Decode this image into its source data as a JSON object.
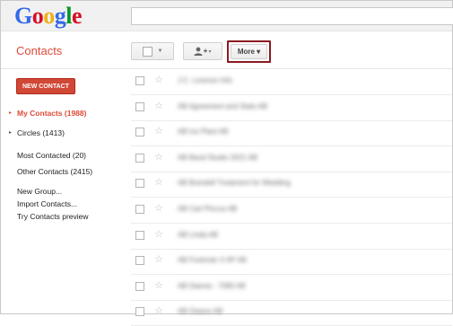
{
  "header": {
    "logo_letters": [
      {
        "char": "G",
        "color": "#3369e8"
      },
      {
        "char": "o",
        "color": "#d50f25"
      },
      {
        "char": "o",
        "color": "#eeb211"
      },
      {
        "char": "g",
        "color": "#3369e8"
      },
      {
        "char": "l",
        "color": "#009925"
      },
      {
        "char": "e",
        "color": "#d50f25"
      }
    ],
    "search_value": ""
  },
  "toolbar": {
    "app_title": "Contacts",
    "select_caret": "▼",
    "add_icon": "add-person-icon",
    "add_label": "+▾",
    "more_label": "More ▾"
  },
  "sidebar": {
    "new_contact_label": "NEW CONTACT",
    "my_contacts": "My Contacts (1988)",
    "circles": "Circles (1413)",
    "most_contacted": "Most Contacted (20)",
    "other_contacts": "Other Contacts (2415)",
    "new_group": "New Group...",
    "import_contacts": "Import Contacts...",
    "try_preview": "Try Contacts preview"
  },
  "contacts": [
    {
      "name": "J.C. Lorenzo Info"
    },
    {
      "name": "AB Agreement and Stats AB"
    },
    {
      "name": "AB Ice Plant AB"
    },
    {
      "name": "AB Band Studio 2021 AB"
    },
    {
      "name": "AB Brandell Treatment for Wedding"
    },
    {
      "name": "AB Carl Pincus AB"
    },
    {
      "name": "AB Linda AB"
    },
    {
      "name": "AB Footnote X AP AB"
    },
    {
      "name": "AB Dianne - 7085 AB"
    },
    {
      "name": "AB Owens AB"
    }
  ],
  "colors": {
    "accent_red": "#dd4b39",
    "new_contact_bg": "#d14836",
    "more_highlight": "#8b1a22"
  }
}
